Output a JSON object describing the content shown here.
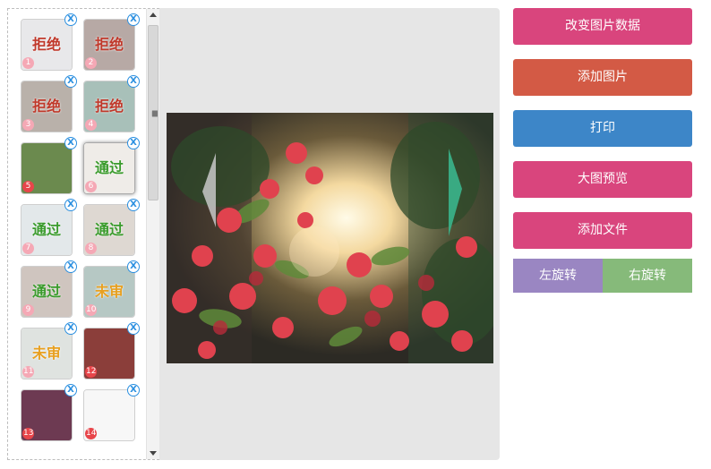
{
  "thumbnails": [
    {
      "number": "1",
      "status": "拒绝",
      "status_color": "#c0392b",
      "num_color": "#f5a8b5",
      "bg": "#e8e8ea"
    },
    {
      "number": "2",
      "status": "拒绝",
      "status_color": "#c0392b",
      "num_color": "#f5a8b5",
      "bg": "#b7a9a5"
    },
    {
      "number": "3",
      "status": "拒绝",
      "status_color": "#c0392b",
      "num_color": "#f5a8b5",
      "bg": "#b9b1aa"
    },
    {
      "number": "4",
      "status": "拒绝",
      "status_color": "#c0392b",
      "num_color": "#f5a8b5",
      "bg": "#a8c0b9"
    },
    {
      "number": "5",
      "status": "",
      "status_color": "#c0392b",
      "num_color": "#e8454a",
      "bg": "#6b8a4e"
    },
    {
      "number": "6",
      "status": "通过",
      "status_color": "#3a9b2c",
      "num_color": "#f5a8b5",
      "bg": "#efece8"
    },
    {
      "number": "7",
      "status": "通过",
      "status_color": "#3a9b2c",
      "num_color": "#f5a8b5",
      "bg": "#e3e8ea"
    },
    {
      "number": "8",
      "status": "通过",
      "status_color": "#3a9b2c",
      "num_color": "#f5a8b5",
      "bg": "#ded8d2"
    },
    {
      "number": "9",
      "status": "通过",
      "status_color": "#3a9b2c",
      "num_color": "#f5a8b5",
      "bg": "#cfc5bf"
    },
    {
      "number": "10",
      "status": "未审",
      "status_color": "#e8a020",
      "num_color": "#f5a8b5",
      "bg": "#b6c8c4"
    },
    {
      "number": "11",
      "status": "未审",
      "status_color": "#e8a020",
      "num_color": "#f5a8b5",
      "bg": "#dfe3e0"
    },
    {
      "number": "12",
      "status": "",
      "status_color": "#c0392b",
      "num_color": "#e8454a",
      "bg": "#8b3e3a"
    },
    {
      "number": "13",
      "status": "",
      "status_color": "#c0392b",
      "num_color": "#e8454a",
      "bg": "#6d3a52"
    },
    {
      "number": "14",
      "status": "",
      "status_color": "#c0392b",
      "num_color": "#e8454a",
      "bg": "#f7f7f7"
    }
  ],
  "close_glyph": "X",
  "buttons": [
    {
      "label": "改变图片数据",
      "color": "#d9457d"
    },
    {
      "label": "添加图片",
      "color": "#d35a45"
    },
    {
      "label": "打印",
      "color": "#3d86c8"
    },
    {
      "label": "大图预览",
      "color": "#d9457d"
    },
    {
      "label": "添加文件",
      "color": "#d9457d"
    }
  ],
  "rotate": {
    "left_label": "左旋转",
    "left_color": "#9a86c2",
    "right_label": "右旋转",
    "right_color": "#86ba7a"
  },
  "icons": {
    "prev": "left-arrow-icon",
    "next": "right-arrow-icon",
    "close": "close-icon",
    "scroll_up": "up-arrow-icon",
    "scroll_down": "down-arrow-icon"
  }
}
